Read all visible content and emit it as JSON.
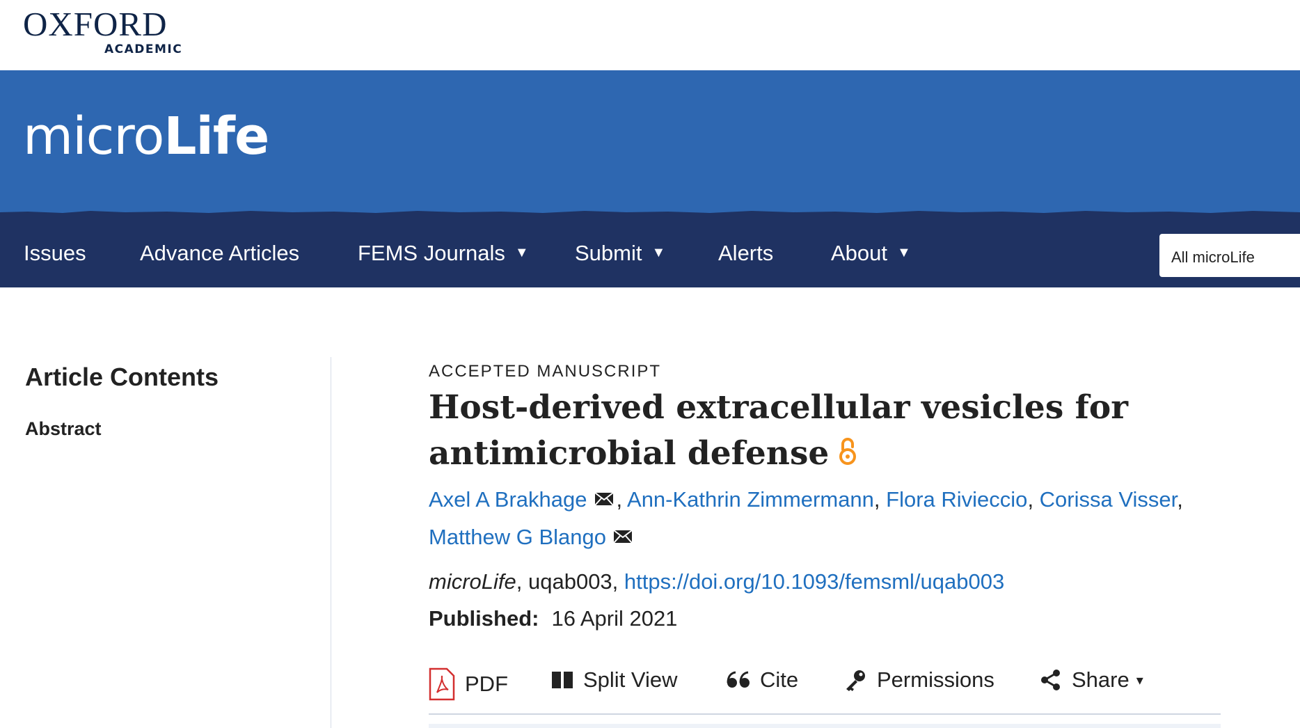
{
  "brand": {
    "oxford": "OXFORD",
    "academic": "ACADEMIC"
  },
  "journal": {
    "name_light": "micro",
    "name_bold": "Life",
    "banner_color": "#2e67b1",
    "nav_color": "#1f3262"
  },
  "nav": {
    "items": [
      {
        "label": "Issues",
        "has_dropdown": false
      },
      {
        "label": "Advance Articles",
        "has_dropdown": false
      },
      {
        "label": "FEMS Journals",
        "has_dropdown": true
      },
      {
        "label": "Submit",
        "has_dropdown": true
      },
      {
        "label": "Alerts",
        "has_dropdown": false
      },
      {
        "label": "About",
        "has_dropdown": true
      }
    ],
    "search_scope": "All microLife",
    "caret": "▼"
  },
  "sidebar": {
    "heading": "Article Contents",
    "items": [
      "Abstract"
    ]
  },
  "article": {
    "kicker": "ACCEPTED MANUSCRIPT",
    "title": "Host-derived extracellular vesicles for antimicrobial defense",
    "open_access_icon": "open-access-icon",
    "authors": [
      {
        "name": "Axel A Brakhage",
        "has_email": true
      },
      {
        "name": "Ann-Kathrin Zimmermann",
        "has_email": false
      },
      {
        "name": "Flora Rivieccio",
        "has_email": false
      },
      {
        "name": "Corissa Visser",
        "has_email": false
      },
      {
        "name": "Matthew G Blango",
        "has_email": true
      }
    ],
    "journal_italic": "microLife",
    "article_id": ", uqab003, ",
    "doi": "https://doi.org/10.1093/femsml/uqab003",
    "published_label": "Published:",
    "published_date": "16 April 2021",
    "link_color": "#1f6fbf",
    "oa_color": "#f7941d"
  },
  "toolbar": {
    "pdf": "PDF",
    "split_view": "Split View",
    "cite": "Cite",
    "permissions": "Permissions",
    "share": "Share",
    "caret": "▾"
  }
}
